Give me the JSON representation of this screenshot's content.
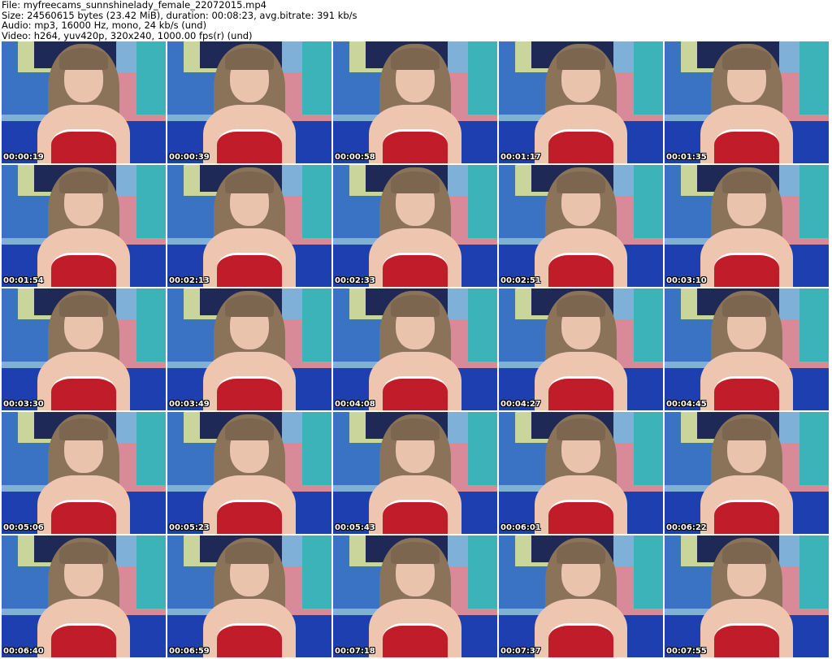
{
  "header": {
    "file": "File: myfreecams_sunnshinelady_female_22072015.mp4",
    "size": "Size: 24560615 bytes (23.42 MiB), duration: 00:08:23, avg.bitrate: 391 kb/s",
    "audio": "Audio: mp3, 16000 Hz, mono, 24 kb/s (und)",
    "video": "Video: h264, yuv420p, 320x240, 1000.00 fps(r) (und)"
  },
  "timestamps": [
    "00:00:19",
    "00:00:39",
    "00:00:58",
    "00:01:17",
    "00:01:35",
    "00:01:54",
    "00:02:13",
    "00:02:33",
    "00:02:51",
    "00:03:10",
    "00:03:30",
    "00:03:49",
    "00:04:08",
    "00:04:27",
    "00:04:45",
    "00:05:06",
    "00:05:23",
    "00:05:43",
    "00:06:01",
    "00:06:22",
    "00:06:40",
    "00:06:59",
    "00:07:18",
    "00:07:37",
    "00:07:55"
  ]
}
